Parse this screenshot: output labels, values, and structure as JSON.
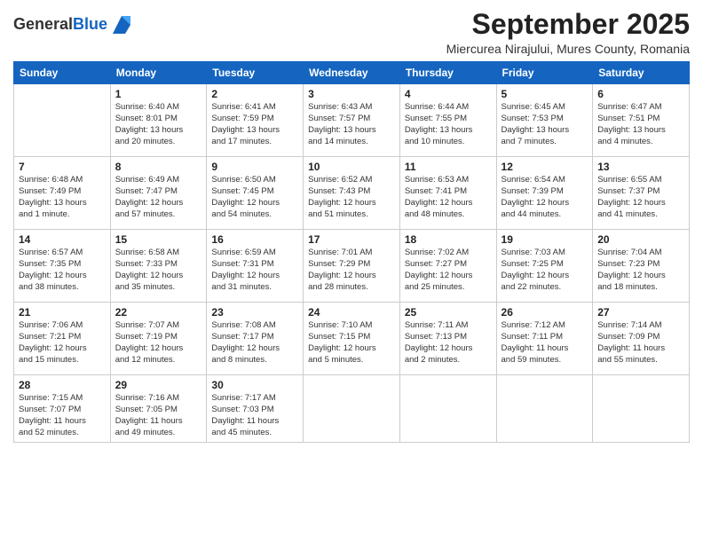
{
  "header": {
    "logo_general": "General",
    "logo_blue": "Blue",
    "month_title": "September 2025",
    "subtitle": "Miercurea Nirajului, Mures County, Romania"
  },
  "weekdays": [
    "Sunday",
    "Monday",
    "Tuesday",
    "Wednesday",
    "Thursday",
    "Friday",
    "Saturday"
  ],
  "weeks": [
    [
      {
        "day": "",
        "info": ""
      },
      {
        "day": "1",
        "info": "Sunrise: 6:40 AM\nSunset: 8:01 PM\nDaylight: 13 hours\nand 20 minutes."
      },
      {
        "day": "2",
        "info": "Sunrise: 6:41 AM\nSunset: 7:59 PM\nDaylight: 13 hours\nand 17 minutes."
      },
      {
        "day": "3",
        "info": "Sunrise: 6:43 AM\nSunset: 7:57 PM\nDaylight: 13 hours\nand 14 minutes."
      },
      {
        "day": "4",
        "info": "Sunrise: 6:44 AM\nSunset: 7:55 PM\nDaylight: 13 hours\nand 10 minutes."
      },
      {
        "day": "5",
        "info": "Sunrise: 6:45 AM\nSunset: 7:53 PM\nDaylight: 13 hours\nand 7 minutes."
      },
      {
        "day": "6",
        "info": "Sunrise: 6:47 AM\nSunset: 7:51 PM\nDaylight: 13 hours\nand 4 minutes."
      }
    ],
    [
      {
        "day": "7",
        "info": "Sunrise: 6:48 AM\nSunset: 7:49 PM\nDaylight: 13 hours\nand 1 minute."
      },
      {
        "day": "8",
        "info": "Sunrise: 6:49 AM\nSunset: 7:47 PM\nDaylight: 12 hours\nand 57 minutes."
      },
      {
        "day": "9",
        "info": "Sunrise: 6:50 AM\nSunset: 7:45 PM\nDaylight: 12 hours\nand 54 minutes."
      },
      {
        "day": "10",
        "info": "Sunrise: 6:52 AM\nSunset: 7:43 PM\nDaylight: 12 hours\nand 51 minutes."
      },
      {
        "day": "11",
        "info": "Sunrise: 6:53 AM\nSunset: 7:41 PM\nDaylight: 12 hours\nand 48 minutes."
      },
      {
        "day": "12",
        "info": "Sunrise: 6:54 AM\nSunset: 7:39 PM\nDaylight: 12 hours\nand 44 minutes."
      },
      {
        "day": "13",
        "info": "Sunrise: 6:55 AM\nSunset: 7:37 PM\nDaylight: 12 hours\nand 41 minutes."
      }
    ],
    [
      {
        "day": "14",
        "info": "Sunrise: 6:57 AM\nSunset: 7:35 PM\nDaylight: 12 hours\nand 38 minutes."
      },
      {
        "day": "15",
        "info": "Sunrise: 6:58 AM\nSunset: 7:33 PM\nDaylight: 12 hours\nand 35 minutes."
      },
      {
        "day": "16",
        "info": "Sunrise: 6:59 AM\nSunset: 7:31 PM\nDaylight: 12 hours\nand 31 minutes."
      },
      {
        "day": "17",
        "info": "Sunrise: 7:01 AM\nSunset: 7:29 PM\nDaylight: 12 hours\nand 28 minutes."
      },
      {
        "day": "18",
        "info": "Sunrise: 7:02 AM\nSunset: 7:27 PM\nDaylight: 12 hours\nand 25 minutes."
      },
      {
        "day": "19",
        "info": "Sunrise: 7:03 AM\nSunset: 7:25 PM\nDaylight: 12 hours\nand 22 minutes."
      },
      {
        "day": "20",
        "info": "Sunrise: 7:04 AM\nSunset: 7:23 PM\nDaylight: 12 hours\nand 18 minutes."
      }
    ],
    [
      {
        "day": "21",
        "info": "Sunrise: 7:06 AM\nSunset: 7:21 PM\nDaylight: 12 hours\nand 15 minutes."
      },
      {
        "day": "22",
        "info": "Sunrise: 7:07 AM\nSunset: 7:19 PM\nDaylight: 12 hours\nand 12 minutes."
      },
      {
        "day": "23",
        "info": "Sunrise: 7:08 AM\nSunset: 7:17 PM\nDaylight: 12 hours\nand 8 minutes."
      },
      {
        "day": "24",
        "info": "Sunrise: 7:10 AM\nSunset: 7:15 PM\nDaylight: 12 hours\nand 5 minutes."
      },
      {
        "day": "25",
        "info": "Sunrise: 7:11 AM\nSunset: 7:13 PM\nDaylight: 12 hours\nand 2 minutes."
      },
      {
        "day": "26",
        "info": "Sunrise: 7:12 AM\nSunset: 7:11 PM\nDaylight: 11 hours\nand 59 minutes."
      },
      {
        "day": "27",
        "info": "Sunrise: 7:14 AM\nSunset: 7:09 PM\nDaylight: 11 hours\nand 55 minutes."
      }
    ],
    [
      {
        "day": "28",
        "info": "Sunrise: 7:15 AM\nSunset: 7:07 PM\nDaylight: 11 hours\nand 52 minutes."
      },
      {
        "day": "29",
        "info": "Sunrise: 7:16 AM\nSunset: 7:05 PM\nDaylight: 11 hours\nand 49 minutes."
      },
      {
        "day": "30",
        "info": "Sunrise: 7:17 AM\nSunset: 7:03 PM\nDaylight: 11 hours\nand 45 minutes."
      },
      {
        "day": "",
        "info": ""
      },
      {
        "day": "",
        "info": ""
      },
      {
        "day": "",
        "info": ""
      },
      {
        "day": "",
        "info": ""
      }
    ]
  ]
}
